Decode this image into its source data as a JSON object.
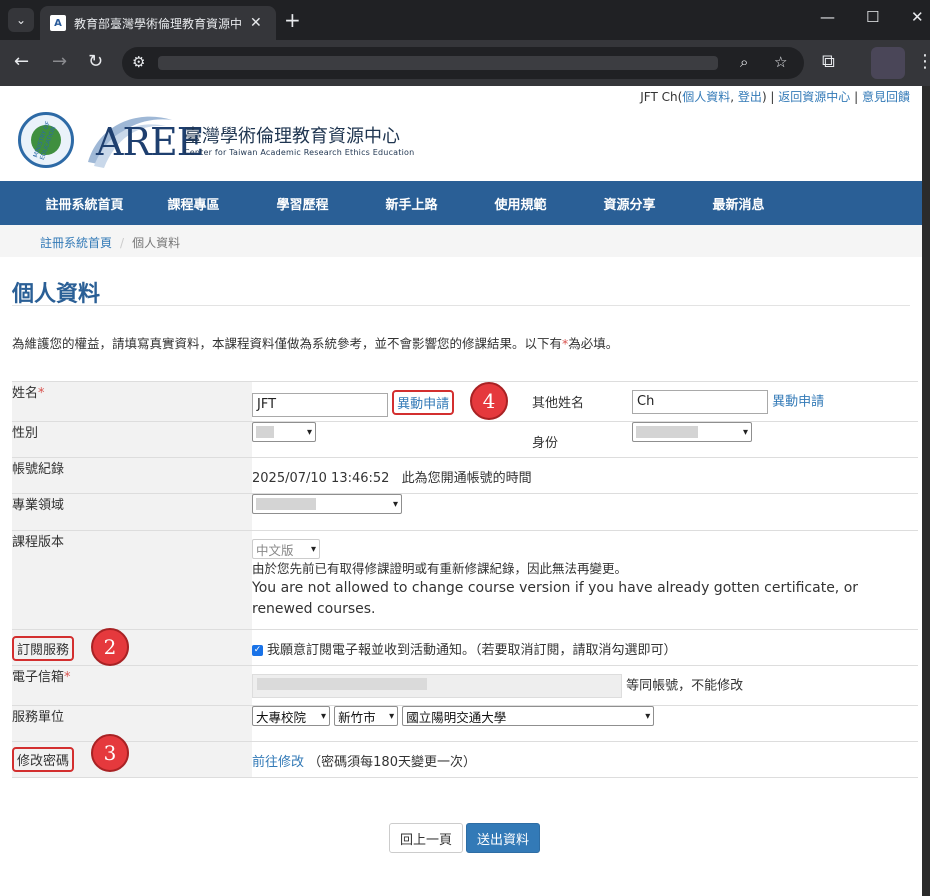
{
  "browser": {
    "tab_title": "教育部臺灣學術倫理教育資源中",
    "new_tab_label": "+",
    "window_controls": [
      "—",
      "☐",
      "✕"
    ]
  },
  "header": {
    "user_name": "JFT Ch(",
    "profile_link": "個人資料",
    "logout_link": "登出",
    "back_link": "返回資源中心",
    "feedback_link": "意見回饋",
    "site_title": "臺灣學術倫理教育資源中心",
    "site_subtitle": "Center for Taiwan Academic Research Ethics Education",
    "logo_text": "AREE",
    "seal_text": "MINISTRY OF EDUCATION"
  },
  "nav": {
    "items": [
      "註冊系統首頁",
      "課程專區",
      "學習歷程",
      "新手上路",
      "使用規範",
      "資源分享",
      "最新消息"
    ]
  },
  "breadcrumb": [
    "註冊系統首頁",
    "個人資料"
  ],
  "page": {
    "title": "個人資料",
    "intro_a": "為維護您的權益，請填寫真實資料，本課程資料僅做為系統參考，並不會影響您的修課結果。以下有",
    "intro_b": "為必填。"
  },
  "form": {
    "name_label": "姓名",
    "name_value": "JFT",
    "change_request": "異動申請",
    "other_name_label": "其他姓名",
    "other_name_value": "Ch",
    "gender_label": "性別",
    "identity_label": "身份",
    "account_log_label": "帳號紀錄",
    "account_log_value": "2025/07/10 13:46:52",
    "account_log_note": "此為您開通帳號的時間",
    "field_label": "專業領域",
    "course_version_label": "課程版本",
    "course_version_value": "中文版",
    "course_version_note_zh": "由於您先前已有取得修課證明或有重新修課紀錄，因此無法再變更。",
    "course_version_note_en": "You are not allowed to change course version if you have already gotten certificate, or renewed courses.",
    "subscribe_label": "訂閱服務",
    "subscribe_text": "我願意訂閱電子報並收到活動通知。（若要取消訂閱，請取消勾選即可）",
    "subscribe_checked": true,
    "email_label": "電子信箱",
    "email_note": "等同帳號，不能修改",
    "unit_label": "服務單位",
    "unit_type": "大專校院",
    "unit_city": "新竹市",
    "unit_name": "國立陽明交通大學",
    "password_label": "修改密碼",
    "password_link": "前往修改",
    "password_note": "（密碼須每180天變更一次）",
    "required_mark": "*"
  },
  "annotations": [
    "2",
    "3",
    "4"
  ],
  "buttons": {
    "back": "回上一頁",
    "submit": "送出資料"
  },
  "colors": {
    "nav_bg": "#2a5f96",
    "link": "#337ab7",
    "annotation_red": "#e5393d",
    "submit_bg": "#337ab7"
  }
}
